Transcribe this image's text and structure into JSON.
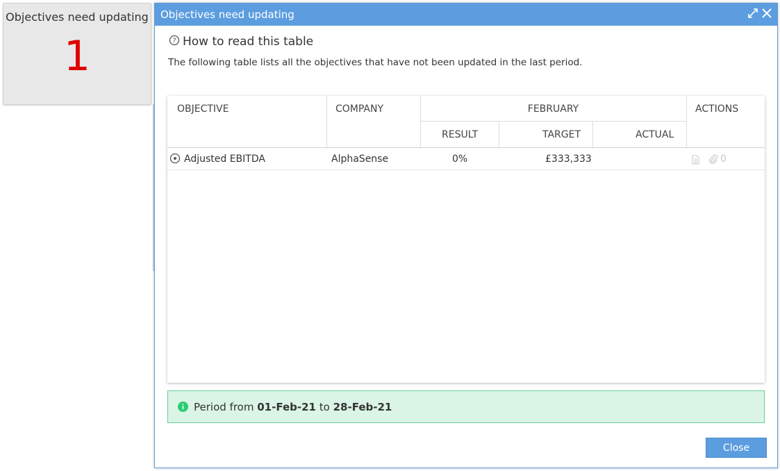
{
  "widget": {
    "title": "Objectives need updating",
    "count": "1"
  },
  "modal": {
    "title": "Objectives need updating",
    "how_title": "How to read this table",
    "description": "The following table lists all the objectives that have not been updated in the last period.",
    "table": {
      "headers": {
        "objective": "OBJECTIVE",
        "company": "COMPANY",
        "period": "FEBRUARY",
        "result": "RESULT",
        "target": "TARGET",
        "actual": "ACTUAL",
        "actions": "ACTIONS"
      },
      "rows": [
        {
          "objective": "Adjusted EBITDA",
          "company": "AlphaSense",
          "result": "0%",
          "target": "£333,333",
          "actual": "",
          "attachments": "0"
        }
      ]
    },
    "period": {
      "prefix": "Period from",
      "from": "01-Feb-21",
      "middle": "to",
      "to": "28-Feb-21"
    },
    "close_label": "Close"
  },
  "colors": {
    "header_blue": "#5b9ddf",
    "count_red": "#e00000",
    "info_green": "#daf5e6",
    "info_icon_green": "#2ecc71"
  },
  "icons": [
    "expand-icon",
    "close-icon",
    "help-circle-icon",
    "objective-target-icon",
    "document-icon",
    "paperclip-icon",
    "info-icon"
  ]
}
